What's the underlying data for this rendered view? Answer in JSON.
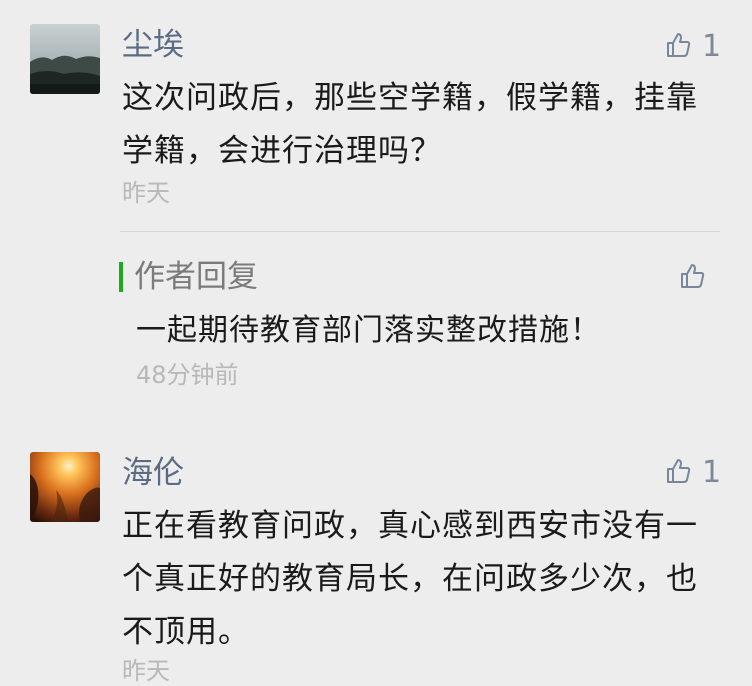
{
  "comments": [
    {
      "username": "尘埃",
      "like_count": "1",
      "text": "这次问政后，那些空学籍，假学籍，挂靠学籍，会进行治理吗？",
      "time": "昨天",
      "avatar": "landscape-avatar"
    },
    {
      "username": "海伦",
      "like_count": "1",
      "text": "正在看教育问政，真心感到西安市没有一个真正好的教育局长，在问政多少次，也不顶用。",
      "time": "昨天",
      "avatar": "sunset-avatar"
    }
  ],
  "reply": {
    "header": "作者回复",
    "text": "一起期待教育部门落实整改措施！",
    "time": "48分钟前"
  },
  "colors": {
    "username": "#5c6b85",
    "reply_bar": "#1aad19",
    "time": "#b8b8b8",
    "background": "#ededed"
  },
  "icons": {
    "like": "thumbs-up-icon"
  }
}
